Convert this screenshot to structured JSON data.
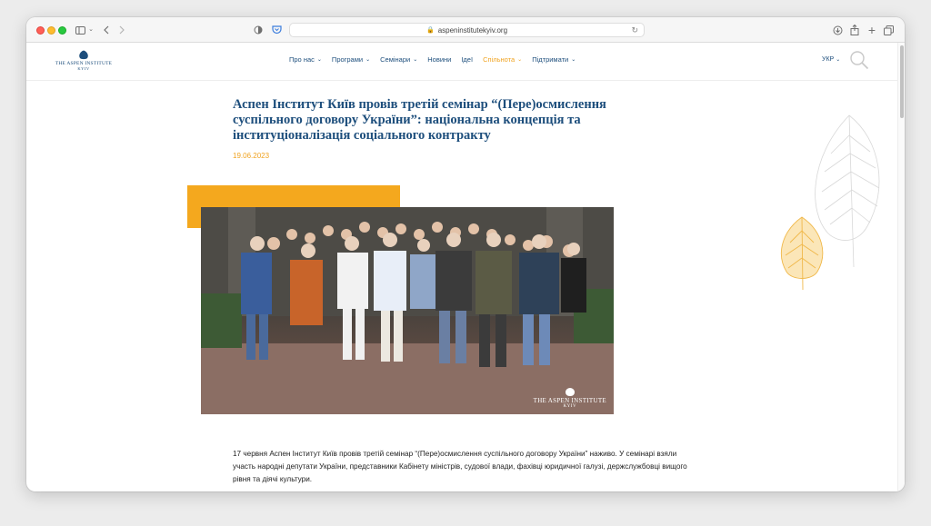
{
  "browser": {
    "url": "aspeninstitutekyiv.org"
  },
  "logo": {
    "line1": "THE ASPEN INSTITUTE",
    "line2": "KYIV"
  },
  "nav": {
    "items": [
      {
        "label": "Про нас",
        "has_dropdown": true
      },
      {
        "label": "Програми",
        "has_dropdown": true
      },
      {
        "label": "Семінари",
        "has_dropdown": true
      },
      {
        "label": "Новини",
        "has_dropdown": false
      },
      {
        "label": "Ідеї",
        "has_dropdown": false
      },
      {
        "label": "Спільнота",
        "has_dropdown": true,
        "active": true
      },
      {
        "label": "Підтримати",
        "has_dropdown": true
      }
    ],
    "language": "УКР"
  },
  "article": {
    "title": "Аспен Інститут Київ провів третій семінар “(Пере)осмислення суспільного договору України”: національна концепція та інституціоналізація соціального контракту",
    "date": "19.06.2023",
    "photo_watermark": {
      "line1": "THE ASPEN INSTITUTE",
      "line2": "KYIV"
    },
    "body": "17 червня Аспен Інститут Київ провів третій семінар “(Пере)осмислення суспільного договору України” наживо. У семінарі взяли участь народні депутати України, представники Кабінету міністрів, судової влади, фахівці юридичної галузі, держслужбовці вищого рівня та діячі культури."
  },
  "colors": {
    "brand_blue": "#1d4e7c",
    "accent_orange": "#f0a320"
  }
}
